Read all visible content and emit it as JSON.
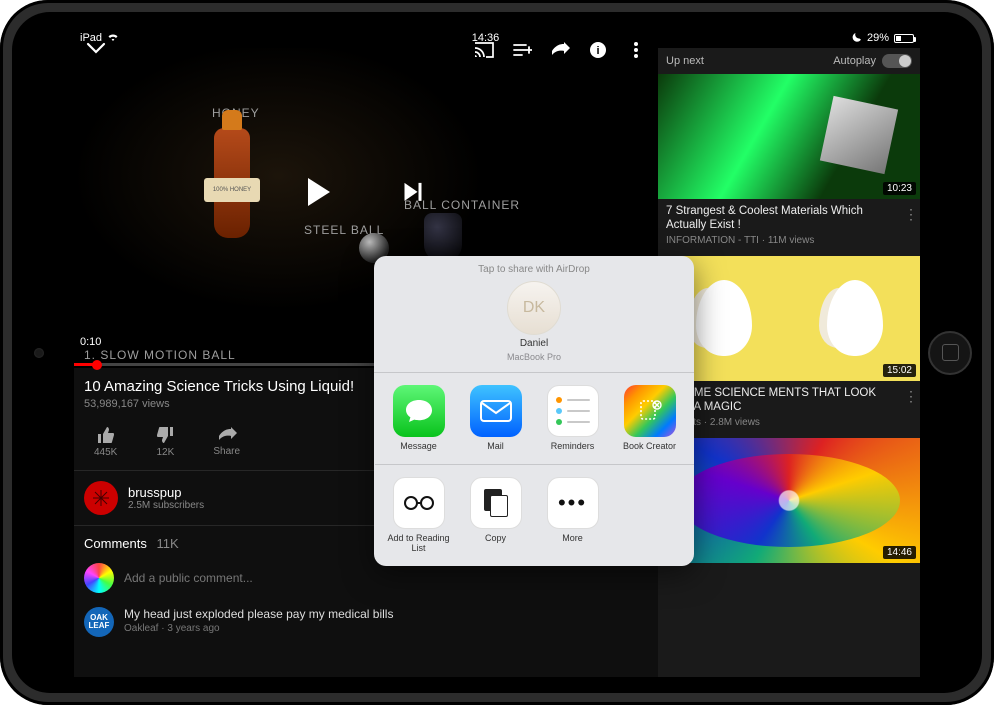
{
  "status": {
    "device": "iPad",
    "time": "14:36",
    "battery": "29%"
  },
  "player": {
    "labels": {
      "honey": "HONEY",
      "steel": "STEEL BALL",
      "container": "BALL CONTAINER"
    },
    "time": "0:10",
    "segment": "1. SLOW MOTION BALL"
  },
  "video": {
    "title": "10 Amazing Science Tricks Using Liquid!",
    "views": "53,989,167 views",
    "likes": "445K",
    "dislikes": "12K",
    "share": "Share"
  },
  "channel": {
    "name": "brusspup",
    "subs": "2.5M subscribers"
  },
  "comments": {
    "label": "Comments",
    "count": "11K",
    "placeholder": "Add a public comment...",
    "top": {
      "avatar": "OAK\nLEAF",
      "text": "My head just exploded please pay my medical bills",
      "author": "Oakleaf",
      "age": "3 years ago"
    }
  },
  "upnext": {
    "label": "Up next",
    "autoplay": "Autoplay",
    "items": [
      {
        "title": "7 Strangest & Coolest Materials Which Actually Exist !",
        "meta_line": "INFORMATION - TTI · 11M views",
        "duration": "10:23"
      },
      {
        "title": "Y HOME SCIENCE MENTS THAT LOOK LIKE A MAGIC",
        "meta_line": "e Crafts · 2.8M views",
        "duration": "15:02"
      },
      {
        "title": "",
        "meta_line": "",
        "duration": "14:46"
      }
    ]
  },
  "share": {
    "airdrop_hint": "Tap to share with AirDrop",
    "airdrop": {
      "initials": "DK",
      "name": "Daniel",
      "device": "MacBook Pro"
    },
    "apps": [
      {
        "label": "Message"
      },
      {
        "label": "Mail"
      },
      {
        "label": "Reminders"
      },
      {
        "label": "Book Creator"
      }
    ],
    "actions": [
      {
        "label": "Add to Reading List"
      },
      {
        "label": "Copy"
      },
      {
        "label": "More"
      }
    ]
  }
}
